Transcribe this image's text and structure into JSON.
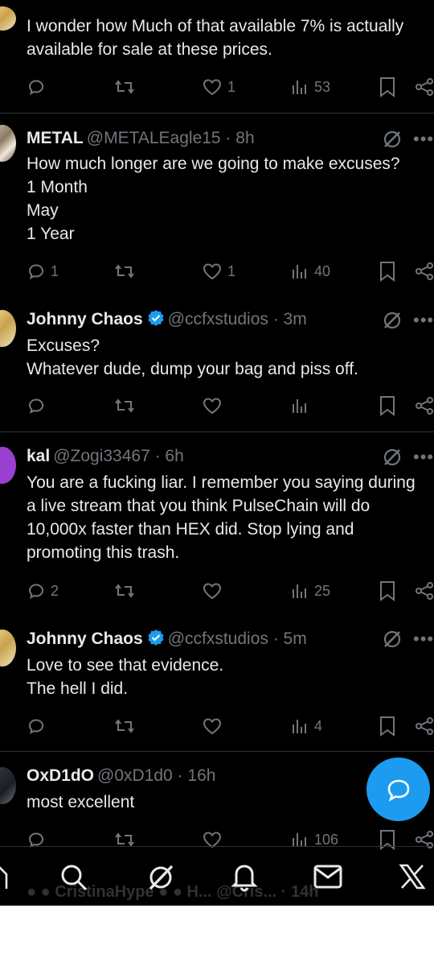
{
  "tweets": [
    {
      "body": "I wonder how Much of that available 7% is actually\navailable for sale at these prices.",
      "replies": "",
      "reposts": "",
      "likes": "1",
      "views": "53"
    },
    {
      "name": "METAL",
      "handle": "@METALEagle15 · 8h",
      "verified": false,
      "body": "How much longer are we going to make excuses?\n1 Month\nMay\n1 Year",
      "replies": "1",
      "reposts": "",
      "likes": "1",
      "views": "40"
    },
    {
      "name": "Johnny Chaos",
      "handle": "@ccfxstudios · 3m",
      "verified": true,
      "body": "Excuses?\nWhatever dude, dump your bag and piss off.",
      "replies": "",
      "reposts": "",
      "likes": "",
      "views": ""
    },
    {
      "name": "kal",
      "handle": "@Zogi33467 · 6h",
      "verified": false,
      "body": "You are a fucking liar. I remember you saying during\na live stream that you think PulseChain will do\n10,000x faster than HEX did. Stop lying and\npromoting this trash.",
      "replies": "2",
      "reposts": "",
      "likes": "",
      "views": "25"
    },
    {
      "name": "Johnny Chaos",
      "handle": "@ccfxstudios · 5m",
      "verified": true,
      "body": "Love to see that evidence.\nThe hell I did.",
      "replies": "",
      "reposts": "",
      "likes": "",
      "views": "4"
    },
    {
      "name": "OxD1dO",
      "handle": "@0xD1d0 · 16h",
      "verified": false,
      "body": "most excellent",
      "replies": "",
      "reposts": "",
      "likes": "",
      "views": "106"
    }
  ],
  "ghost_row": "● ● CristinaHype ● ● H...  @Cris...  · 14h",
  "colors": {
    "accent": "#1d9bf0",
    "muted": "#71767b",
    "divider": "#2f3336",
    "background": "#000000",
    "text": "#e7e9ea"
  },
  "nav": [
    "home-icon",
    "search-icon",
    "grok-icon",
    "notifications-icon",
    "messages-icon",
    "x-logo-icon"
  ],
  "fab_icon": "compose-reply-icon"
}
